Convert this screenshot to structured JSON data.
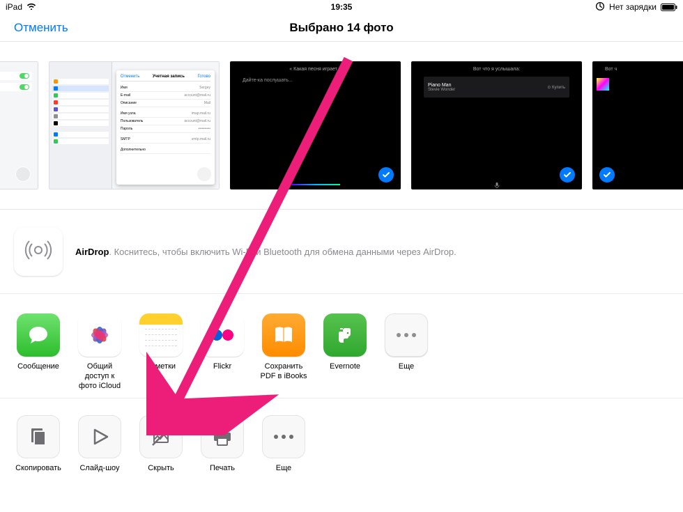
{
  "status": {
    "device": "iPad",
    "time": "19:35",
    "no_charge_label": "Нет зарядки"
  },
  "nav": {
    "cancel": "Отменить",
    "title": "Выбрано 14 фото"
  },
  "thumbs": [
    {
      "selected": false,
      "kind": "settings-right"
    },
    {
      "selected": false,
      "kind": "settings-popup"
    },
    {
      "selected": true,
      "kind": "siri-listen",
      "top_text": "« Какая песня играет »",
      "sub_text": "Дайте-ка послушать..."
    },
    {
      "selected": true,
      "kind": "now-playing",
      "top_text": "Вот что я услышала:",
      "np_title": "Piano Man",
      "np_artist": "Stevie Wonder"
    },
    {
      "selected": true,
      "kind": "siri-result-partial",
      "top_text": "Вот ч"
    }
  ],
  "airdrop": {
    "bold": "AirDrop",
    "rest": ". Коснитесь, чтобы включить Wi-Fi и Bluetooth для обмена данными через AirDrop."
  },
  "apps": [
    {
      "label": "Сообщение"
    },
    {
      "label": "Общий доступ к фото iCloud"
    },
    {
      "label": "Заметки"
    },
    {
      "label": "Flickr"
    },
    {
      "label": "Сохранить PDF в iBooks"
    },
    {
      "label": "Evernote"
    },
    {
      "label": "Еще"
    }
  ],
  "actions": [
    {
      "label": "Скопировать"
    },
    {
      "label": "Слайд-шоу"
    },
    {
      "label": "Скрыть"
    },
    {
      "label": "Печать"
    },
    {
      "label": "Еще"
    }
  ]
}
